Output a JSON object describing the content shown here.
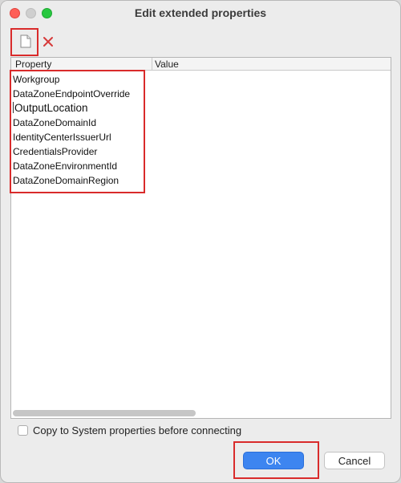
{
  "window": {
    "title": "Edit extended properties"
  },
  "toolbar": {
    "new_icon": "new-document-icon",
    "delete_icon": "delete-x-icon"
  },
  "table": {
    "columns": [
      "Property",
      "Value"
    ],
    "rows": [
      {
        "property": "Workgroup",
        "value": ""
      },
      {
        "property": "DataZoneEndpointOverride",
        "value": ""
      },
      {
        "property": "OutputLocation",
        "value": ""
      },
      {
        "property": "DataZoneDomainId",
        "value": ""
      },
      {
        "property": "IdentityCenterIssuerUrl",
        "value": ""
      },
      {
        "property": "CredentialsProvider",
        "value": ""
      },
      {
        "property": "DataZoneEnvironmentId",
        "value": ""
      },
      {
        "property": "DataZoneDomainRegion",
        "value": ""
      }
    ]
  },
  "options": {
    "copy_to_system_label": "Copy to System properties before connecting",
    "copy_to_system_checked": false
  },
  "buttons": {
    "ok_label": "OK",
    "cancel_label": "Cancel"
  },
  "colors": {
    "primary_button": "#3d85f0",
    "highlight_box": "#d92b2b"
  }
}
